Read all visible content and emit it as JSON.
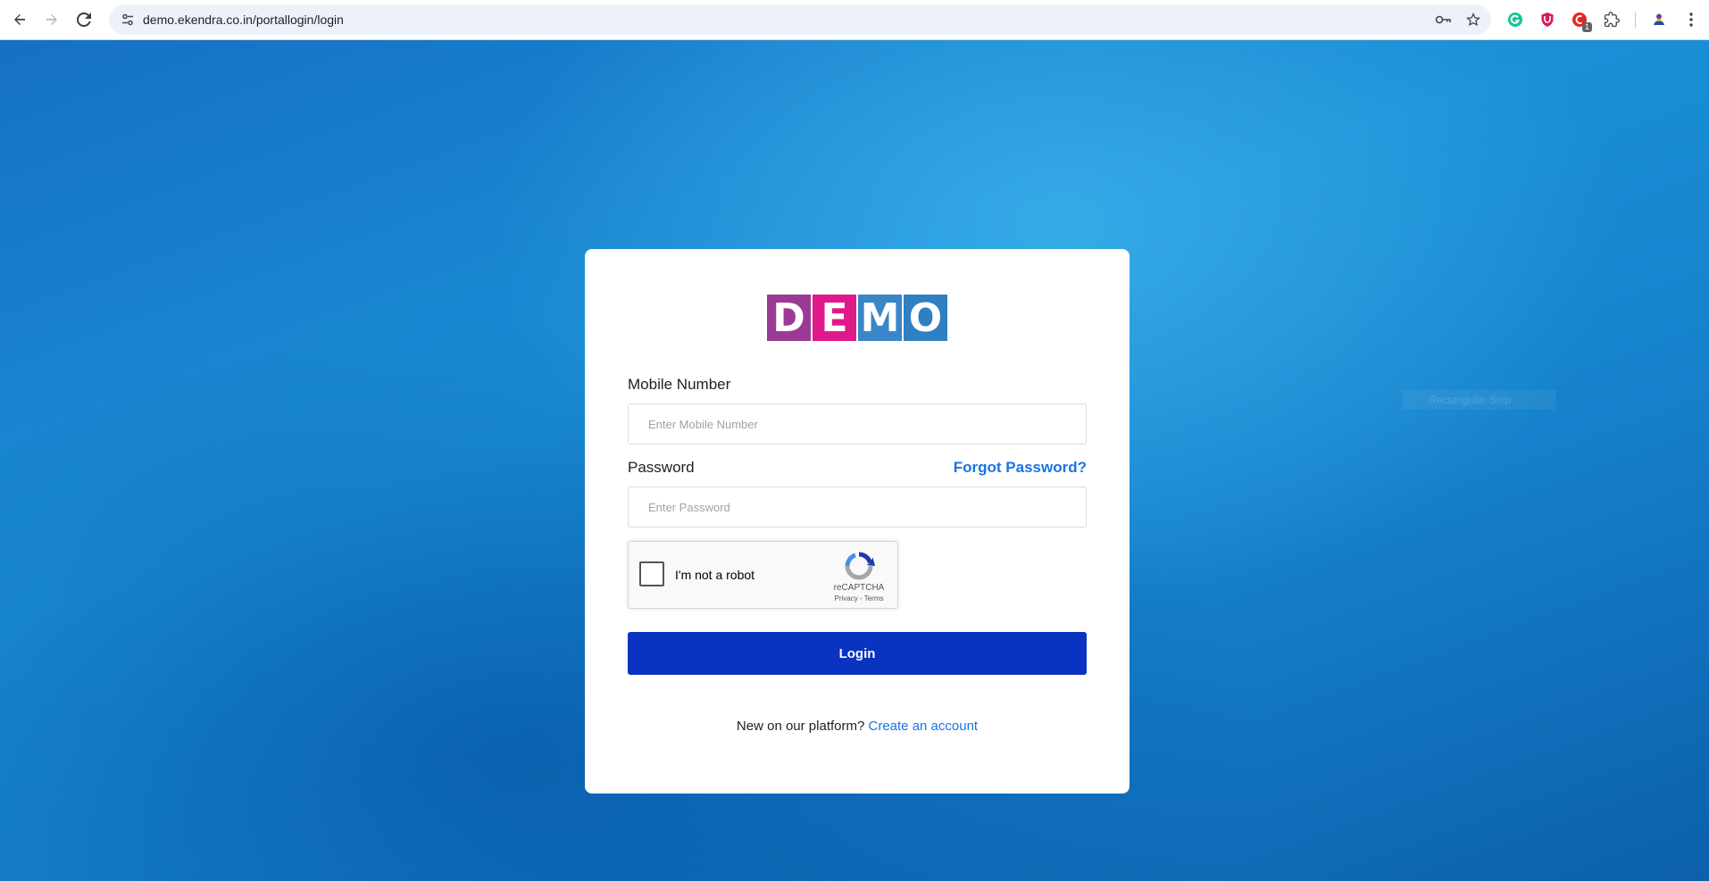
{
  "browser": {
    "url": "demo.ekendra.co.in/portallogin/login",
    "icons": {
      "back": "arrow-left-icon",
      "forward": "arrow-right-icon",
      "reload": "reload-icon",
      "site_info": "tune-icon",
      "password_key": "key-icon",
      "bookmark": "star-icon",
      "extensions": "puzzle-icon",
      "menu": "kebab-menu-icon"
    },
    "extension_badge": "1"
  },
  "background_tooltip": "Rectangular Snip",
  "login": {
    "logo_letters": [
      {
        "char": "D",
        "color": "#9b3a93"
      },
      {
        "char": "E",
        "color": "#e0198a"
      },
      {
        "char": "M",
        "color": "#3a86c8"
      },
      {
        "char": "O",
        "color": "#2f7fc3"
      }
    ],
    "mobile_label": "Mobile Number",
    "mobile_placeholder": "Enter Mobile Number",
    "password_label": "Password",
    "password_placeholder": "Enter Password",
    "forgot_password": "Forgot Password?",
    "recaptcha": {
      "label": "I'm not a robot",
      "brand": "reCAPTCHA",
      "privacy": "Privacy",
      "separator": " - ",
      "terms": "Terms"
    },
    "login_button": "Login",
    "signup_prompt": "New on our platform?",
    "signup_link": "Create an account"
  },
  "colors": {
    "login_button": "#0a33c2",
    "link": "#1a73e8",
    "background": "#1a8fd6"
  }
}
